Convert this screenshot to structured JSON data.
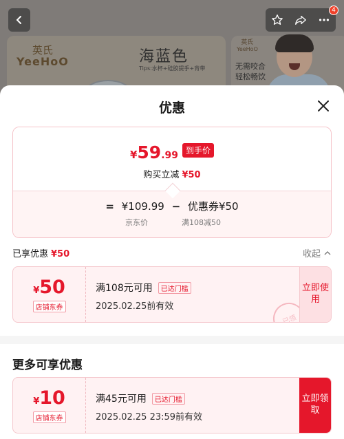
{
  "background": {
    "banner_left": {
      "brand_cn": "英氏",
      "brand_en": "YeeHoO",
      "title": "海蓝色",
      "subtitle": "Tips:水杯+硅胶提手+背带"
    },
    "banner_right": {
      "brand_cn": "英氏",
      "brand_en": "YeeHoO",
      "text_line1": "无需咬合",
      "text_line2": "轻松畅饮"
    },
    "cart_badge": "4"
  },
  "sheet": {
    "title": "优惠",
    "summary": {
      "currency": "¥",
      "price_int": "59",
      "price_dec": ".99",
      "price_tag": "到手价",
      "reduce_label": "购买立减",
      "reduce_amount": "¥50",
      "formula": {
        "equals": "=",
        "jd_price": "¥109.99",
        "minus": "−",
        "coupon_label": "优惠券¥50",
        "jd_price_label": "京东价",
        "coupon_rule": "满108减50"
      }
    },
    "enjoyed": {
      "label": "已享优惠",
      "amount": "¥50",
      "collapse": "收起"
    },
    "applied_coupon": {
      "currency": "¥",
      "amount": "50",
      "type": "店铺东券",
      "condition": "满108元可用",
      "threshold": "已达门槛",
      "valid": "2025.02.25前有效",
      "action": "立即使用",
      "stamp": "已领"
    },
    "more_title": "更多可享优惠",
    "more_coupon": {
      "currency": "¥",
      "amount": "10",
      "type": "店铺东券",
      "condition": "满45元可用",
      "threshold": "已达门槛",
      "valid": "2025.02.25 23:59前有效",
      "action": "立即领取"
    }
  },
  "colors": {
    "accent": "#e5172b",
    "coupon_bg": "#fff2f3",
    "border": "#f5c2c8"
  }
}
